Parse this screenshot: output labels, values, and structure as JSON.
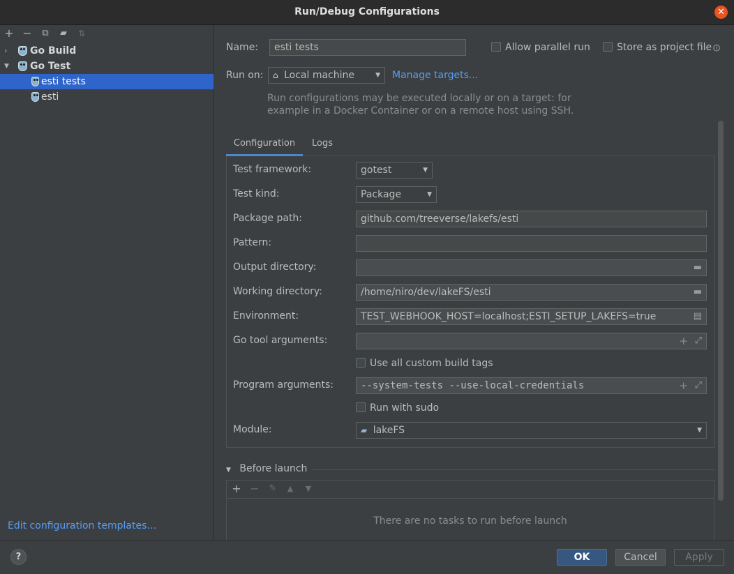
{
  "window": {
    "title": "Run/Debug Configurations"
  },
  "sidebar": {
    "tree": {
      "go_build": "Go Build",
      "go_test": "Go Test",
      "esti_tests": "esti tests",
      "esti": "esti"
    },
    "edit_templates": "Edit configuration templates…"
  },
  "header": {
    "name_label": "Name:",
    "name_value": "esti tests",
    "allow_parallel": "Allow parallel run",
    "store_as_project": "Store as project file",
    "run_on_label": "Run on:",
    "run_on_value": "Local machine",
    "manage_targets": "Manage targets...",
    "hint_line1": "Run configurations may be executed locally or on a target: for",
    "hint_line2": "example in a Docker Container or on a remote host using SSH."
  },
  "tabs": {
    "configuration": "Configuration",
    "logs": "Logs"
  },
  "config": {
    "test_framework_label": "Test framework:",
    "test_framework_value": "gotest",
    "test_kind_label": "Test kind:",
    "test_kind_value": "Package",
    "package_path_label": "Package path:",
    "package_path_value": "github.com/treeverse/lakefs/esti",
    "pattern_label": "Pattern:",
    "pattern_value": "",
    "output_dir_label": "Output directory:",
    "output_dir_value": "",
    "working_dir_label": "Working directory:",
    "working_dir_value": "/home/niro/dev/lakeFS/esti",
    "environment_label": "Environment:",
    "environment_value": "TEST_WEBHOOK_HOST=localhost;ESTI_SETUP_LAKEFS=true",
    "go_tool_args_label": "Go tool arguments:",
    "go_tool_args_value": "",
    "custom_build_tags": "Use all custom build tags",
    "program_args_label": "Program arguments:",
    "program_args_value": "--system-tests --use-local-credentials",
    "run_with_sudo": "Run with sudo",
    "module_label": "Module:",
    "module_value": "lakeFS"
  },
  "before_launch": {
    "title": "Before launch",
    "empty": "There are no tasks to run before launch"
  },
  "footer": {
    "help": "?",
    "ok": "OK",
    "cancel": "Cancel",
    "apply": "Apply"
  },
  "colors": {
    "accent": "#2f65ca",
    "link": "#589df6",
    "primary_button": "#365880",
    "close": "#e95420"
  }
}
